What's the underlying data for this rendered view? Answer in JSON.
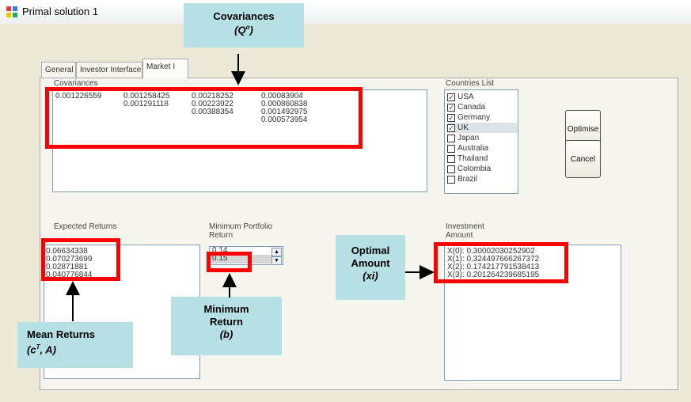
{
  "window": {
    "title": "Primal solution 1"
  },
  "tabs": [
    "General",
    "Investor Interface",
    "Market I"
  ],
  "covariances": {
    "label": "Covariances",
    "columns": [
      [
        "0.001226559"
      ],
      [
        "0.001258425",
        "0.001291118"
      ],
      [
        "0.00218252",
        "0.00223922",
        "0.00388354"
      ],
      [
        "0.00083904",
        "0.000860838",
        "0.001492975",
        "0.000573954"
      ]
    ]
  },
  "countries": {
    "label": "Countries List",
    "items": [
      {
        "name": "USA",
        "checked": true
      },
      {
        "name": "Canada",
        "checked": true
      },
      {
        "name": "Germany",
        "checked": true
      },
      {
        "name": "UK",
        "checked": true
      },
      {
        "name": "Japan",
        "checked": false
      },
      {
        "name": "Australia",
        "checked": false
      },
      {
        "name": "Thailand",
        "checked": false
      },
      {
        "name": "Colombia",
        "checked": false
      },
      {
        "name": "Brazil",
        "checked": false
      }
    ]
  },
  "buttons": {
    "optimise": "Optimise",
    "cancel": "Cancel"
  },
  "expected_returns": {
    "label": "Expected Returns",
    "values": [
      "0.06634338",
      "0.070273699",
      "0.02871881",
      "0.040776844"
    ]
  },
  "min_portfolio": {
    "label_line1": "Minimum Portfolio",
    "label_line2": "Return",
    "options": [
      "0.14",
      "0.15"
    ],
    "selected": "0.15"
  },
  "investment": {
    "label_line1": "Investment",
    "label_line2": "Amount",
    "values": [
      "X(0): 0.30002030252902",
      "X(1): 0.324497666267372",
      "X(2): 0.174217791538413",
      "X(3): 0.201264239685195"
    ]
  },
  "annotations": {
    "covariances": {
      "title": "Covariances",
      "symbol": "(Q",
      "sup": "o",
      "close": ")"
    },
    "optimal": {
      "line1": "Optimal",
      "line2": "Amount",
      "line3": "(xi)"
    },
    "minimum": {
      "line1": "Minimum",
      "line2": "Return",
      "line3": "(b)"
    },
    "mean": {
      "line1": "Mean Returns",
      "symbol": "(c",
      "sup": "T",
      "rest": ", A)"
    }
  },
  "colors": {
    "highlight": "#ff0000",
    "callout": "#b6e0e4",
    "window_bg": "#ece9d8"
  }
}
